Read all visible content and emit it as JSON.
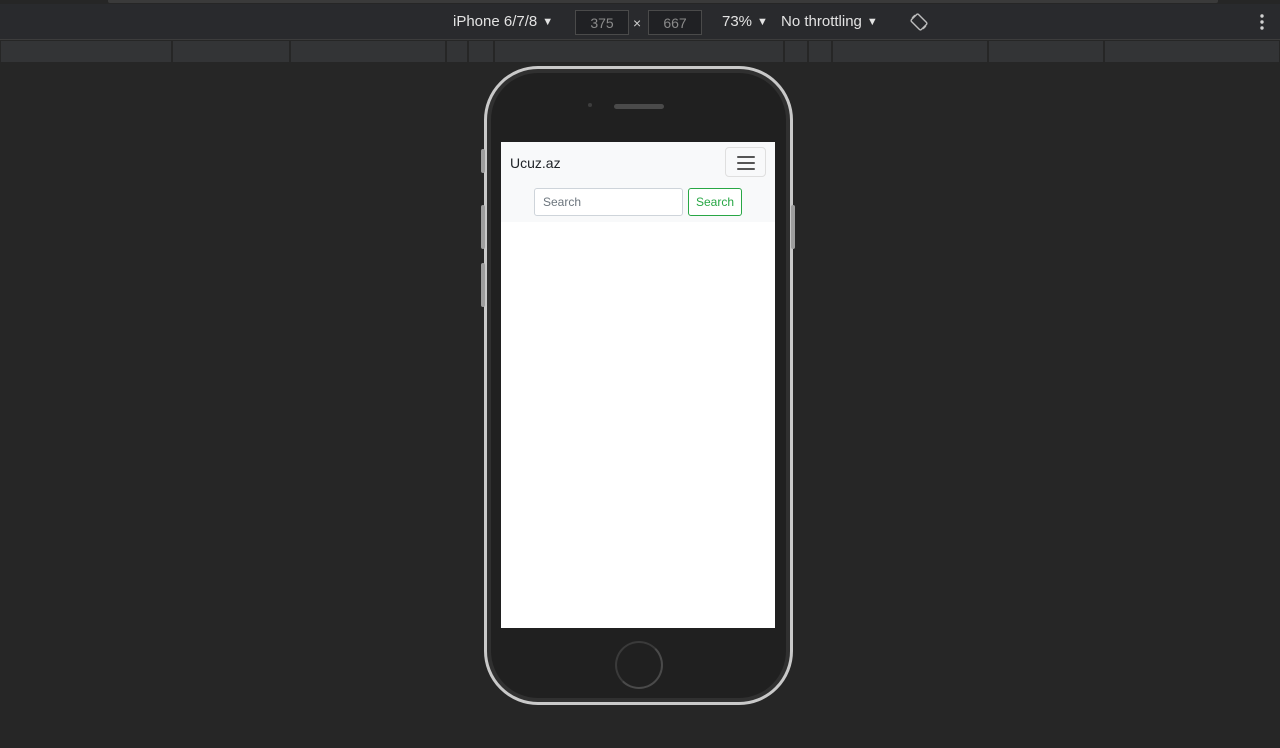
{
  "toolbar": {
    "device": "iPhone 6/7/8",
    "width_value": "375",
    "height_value": "667",
    "dimension_separator": "×",
    "zoom": "73%",
    "throttling": "No throttling",
    "caret_glyph": "▼"
  },
  "app": {
    "brand": "Ucuz.az",
    "search_placeholder": "Search",
    "search_button": "Search"
  },
  "icons": {
    "rotate": "rotate-icon",
    "more": "more-vertical-icon",
    "menu": "hamburger-menu-icon",
    "caret": "caret-down-icon"
  },
  "colors": {
    "devtools_bg": "#262626",
    "toolbar_bg": "#292a2d",
    "navbar_bg": "#f8f9fa",
    "success": "#28a745"
  }
}
